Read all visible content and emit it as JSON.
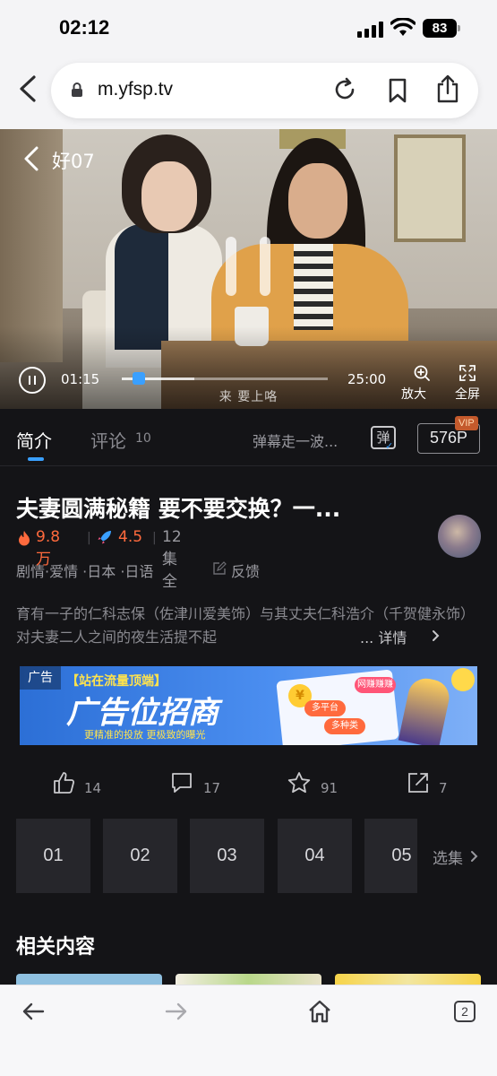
{
  "status_bar": {
    "time": "02:12",
    "battery": "83",
    "icons": [
      "signal-icon",
      "wifi-icon",
      "battery-icon"
    ]
  },
  "browser": {
    "url": "m.yfsp.tv",
    "icons": [
      "back-icon",
      "lock-icon",
      "reload-icon",
      "bookmark-icon",
      "share-icon"
    ]
  },
  "player": {
    "title": "好07",
    "current_time": "01:15",
    "duration": "25:00",
    "progress_fraction": 0.05,
    "buffered_fraction": 0.35,
    "subtitle": "来 要上咯",
    "zoom_label": "放大",
    "fullscreen_label": "全屏"
  },
  "tabs": {
    "intro": "简介",
    "comments": "评论",
    "comments_count": "10",
    "danmu_placeholder": "弹幕走一波...",
    "danmu_button": "弹",
    "quality": "576P",
    "vip": "VIP"
  },
  "show": {
    "title": "夫妻圆满秘籍 要不要交换？一...",
    "heat": "9.8万",
    "score": "4.5",
    "episodes_total": "12集全",
    "tags": "剧情·爱情  ·日本  ·日语",
    "feedback": "反馈",
    "description": "育有一子的仁科志保（佐津川爱美饰）与其丈夫仁科浩介（千贺健永饰）对夫妻二人之间的夜生活提不起",
    "more": "...  详情"
  },
  "ad": {
    "tag": "广告",
    "top_text": "【站在流量顶端】",
    "main_text": "广告位招商",
    "sub_text": "更精准的投放  更极致的曝光",
    "badge1": "多平台",
    "badge2": "多种类",
    "badge3": "网赚赚赚"
  },
  "actions": {
    "like_count": "14",
    "comment_count": "17",
    "favorite_count": "91",
    "share_count": "7"
  },
  "episodes": {
    "items": [
      "01",
      "02",
      "03",
      "04",
      "05"
    ],
    "more": "选集"
  },
  "related": {
    "title": "相关内容"
  },
  "toolbar": {
    "tab_count": "2"
  },
  "colors": {
    "accent_blue": "#3aa0ff",
    "heat_orange": "#ff6a3d",
    "app_background": "#141417"
  }
}
